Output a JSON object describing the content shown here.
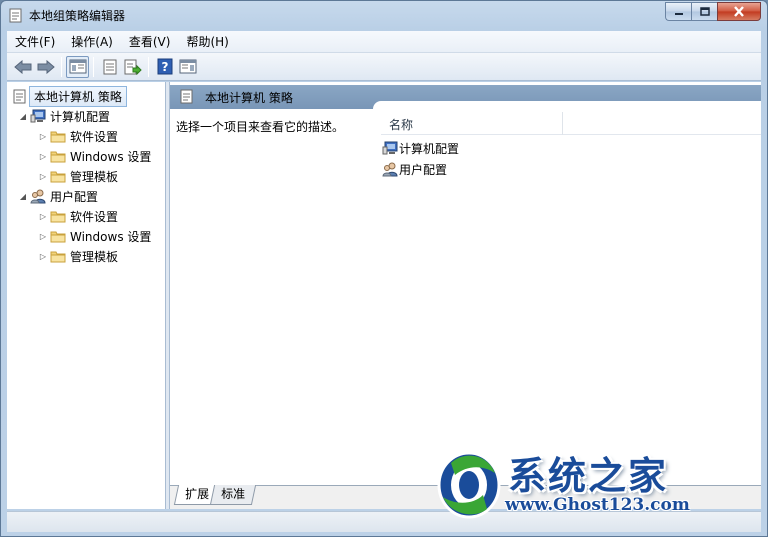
{
  "window": {
    "title": "本地组策略编辑器"
  },
  "menubar": {
    "items": [
      "文件(F)",
      "操作(A)",
      "查看(V)",
      "帮助(H)"
    ]
  },
  "toolbar": {
    "buttons": [
      "back-arrow-icon",
      "forward-arrow-icon",
      "show-tree-icon",
      "properties-icon",
      "export-list-icon",
      "help-icon",
      "show-action-pane-icon"
    ]
  },
  "tree": {
    "root": "本地计算机 策略",
    "computer": {
      "label": "计算机配置",
      "children": [
        "软件设置",
        "Windows 设置",
        "管理模板"
      ]
    },
    "user": {
      "label": "用户配置",
      "children": [
        "软件设置",
        "Windows 设置",
        "管理模板"
      ]
    }
  },
  "right_pane": {
    "header_title": "本地计算机 策略",
    "description": "选择一个项目来查看它的描述。",
    "column_name": "名称",
    "rows": [
      "计算机配置",
      "用户配置"
    ],
    "tabs": [
      "扩展",
      "标准"
    ]
  },
  "watermark": {
    "text": "系统之家",
    "url": "www.Ghost123.com"
  }
}
